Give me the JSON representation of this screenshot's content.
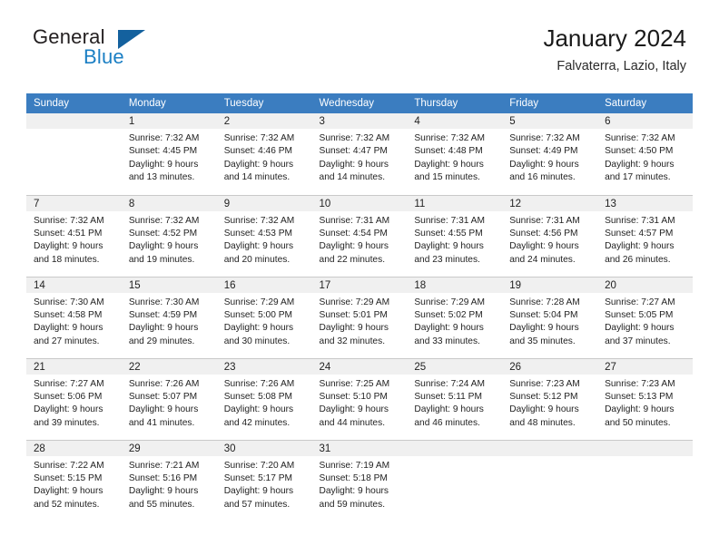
{
  "brand": {
    "name_part1": "General",
    "name_part2": "Blue",
    "flag_icon": "triangle-flag-icon"
  },
  "header": {
    "title": "January 2024",
    "location": "Falvaterra, Lazio, Italy"
  },
  "calendar": {
    "weekday_headers": [
      "Sunday",
      "Monday",
      "Tuesday",
      "Wednesday",
      "Thursday",
      "Friday",
      "Saturday"
    ],
    "accent_color": "#3b7dc0",
    "daynum_bg_color": "#f0f0f0",
    "weeks": [
      [
        {
          "day": "",
          "sunrise": "",
          "sunset": "",
          "daylight_line1": "",
          "daylight_line2": ""
        },
        {
          "day": "1",
          "sunrise": "Sunrise: 7:32 AM",
          "sunset": "Sunset: 4:45 PM",
          "daylight_line1": "Daylight: 9 hours",
          "daylight_line2": "and 13 minutes."
        },
        {
          "day": "2",
          "sunrise": "Sunrise: 7:32 AM",
          "sunset": "Sunset: 4:46 PM",
          "daylight_line1": "Daylight: 9 hours",
          "daylight_line2": "and 14 minutes."
        },
        {
          "day": "3",
          "sunrise": "Sunrise: 7:32 AM",
          "sunset": "Sunset: 4:47 PM",
          "daylight_line1": "Daylight: 9 hours",
          "daylight_line2": "and 14 minutes."
        },
        {
          "day": "4",
          "sunrise": "Sunrise: 7:32 AM",
          "sunset": "Sunset: 4:48 PM",
          "daylight_line1": "Daylight: 9 hours",
          "daylight_line2": "and 15 minutes."
        },
        {
          "day": "5",
          "sunrise": "Sunrise: 7:32 AM",
          "sunset": "Sunset: 4:49 PM",
          "daylight_line1": "Daylight: 9 hours",
          "daylight_line2": "and 16 minutes."
        },
        {
          "day": "6",
          "sunrise": "Sunrise: 7:32 AM",
          "sunset": "Sunset: 4:50 PM",
          "daylight_line1": "Daylight: 9 hours",
          "daylight_line2": "and 17 minutes."
        }
      ],
      [
        {
          "day": "7",
          "sunrise": "Sunrise: 7:32 AM",
          "sunset": "Sunset: 4:51 PM",
          "daylight_line1": "Daylight: 9 hours",
          "daylight_line2": "and 18 minutes."
        },
        {
          "day": "8",
          "sunrise": "Sunrise: 7:32 AM",
          "sunset": "Sunset: 4:52 PM",
          "daylight_line1": "Daylight: 9 hours",
          "daylight_line2": "and 19 minutes."
        },
        {
          "day": "9",
          "sunrise": "Sunrise: 7:32 AM",
          "sunset": "Sunset: 4:53 PM",
          "daylight_line1": "Daylight: 9 hours",
          "daylight_line2": "and 20 minutes."
        },
        {
          "day": "10",
          "sunrise": "Sunrise: 7:31 AM",
          "sunset": "Sunset: 4:54 PM",
          "daylight_line1": "Daylight: 9 hours",
          "daylight_line2": "and 22 minutes."
        },
        {
          "day": "11",
          "sunrise": "Sunrise: 7:31 AM",
          "sunset": "Sunset: 4:55 PM",
          "daylight_line1": "Daylight: 9 hours",
          "daylight_line2": "and 23 minutes."
        },
        {
          "day": "12",
          "sunrise": "Sunrise: 7:31 AM",
          "sunset": "Sunset: 4:56 PM",
          "daylight_line1": "Daylight: 9 hours",
          "daylight_line2": "and 24 minutes."
        },
        {
          "day": "13",
          "sunrise": "Sunrise: 7:31 AM",
          "sunset": "Sunset: 4:57 PM",
          "daylight_line1": "Daylight: 9 hours",
          "daylight_line2": "and 26 minutes."
        }
      ],
      [
        {
          "day": "14",
          "sunrise": "Sunrise: 7:30 AM",
          "sunset": "Sunset: 4:58 PM",
          "daylight_line1": "Daylight: 9 hours",
          "daylight_line2": "and 27 minutes."
        },
        {
          "day": "15",
          "sunrise": "Sunrise: 7:30 AM",
          "sunset": "Sunset: 4:59 PM",
          "daylight_line1": "Daylight: 9 hours",
          "daylight_line2": "and 29 minutes."
        },
        {
          "day": "16",
          "sunrise": "Sunrise: 7:29 AM",
          "sunset": "Sunset: 5:00 PM",
          "daylight_line1": "Daylight: 9 hours",
          "daylight_line2": "and 30 minutes."
        },
        {
          "day": "17",
          "sunrise": "Sunrise: 7:29 AM",
          "sunset": "Sunset: 5:01 PM",
          "daylight_line1": "Daylight: 9 hours",
          "daylight_line2": "and 32 minutes."
        },
        {
          "day": "18",
          "sunrise": "Sunrise: 7:29 AM",
          "sunset": "Sunset: 5:02 PM",
          "daylight_line1": "Daylight: 9 hours",
          "daylight_line2": "and 33 minutes."
        },
        {
          "day": "19",
          "sunrise": "Sunrise: 7:28 AM",
          "sunset": "Sunset: 5:04 PM",
          "daylight_line1": "Daylight: 9 hours",
          "daylight_line2": "and 35 minutes."
        },
        {
          "day": "20",
          "sunrise": "Sunrise: 7:27 AM",
          "sunset": "Sunset: 5:05 PM",
          "daylight_line1": "Daylight: 9 hours",
          "daylight_line2": "and 37 minutes."
        }
      ],
      [
        {
          "day": "21",
          "sunrise": "Sunrise: 7:27 AM",
          "sunset": "Sunset: 5:06 PM",
          "daylight_line1": "Daylight: 9 hours",
          "daylight_line2": "and 39 minutes."
        },
        {
          "day": "22",
          "sunrise": "Sunrise: 7:26 AM",
          "sunset": "Sunset: 5:07 PM",
          "daylight_line1": "Daylight: 9 hours",
          "daylight_line2": "and 41 minutes."
        },
        {
          "day": "23",
          "sunrise": "Sunrise: 7:26 AM",
          "sunset": "Sunset: 5:08 PM",
          "daylight_line1": "Daylight: 9 hours",
          "daylight_line2": "and 42 minutes."
        },
        {
          "day": "24",
          "sunrise": "Sunrise: 7:25 AM",
          "sunset": "Sunset: 5:10 PM",
          "daylight_line1": "Daylight: 9 hours",
          "daylight_line2": "and 44 minutes."
        },
        {
          "day": "25",
          "sunrise": "Sunrise: 7:24 AM",
          "sunset": "Sunset: 5:11 PM",
          "daylight_line1": "Daylight: 9 hours",
          "daylight_line2": "and 46 minutes."
        },
        {
          "day": "26",
          "sunrise": "Sunrise: 7:23 AM",
          "sunset": "Sunset: 5:12 PM",
          "daylight_line1": "Daylight: 9 hours",
          "daylight_line2": "and 48 minutes."
        },
        {
          "day": "27",
          "sunrise": "Sunrise: 7:23 AM",
          "sunset": "Sunset: 5:13 PM",
          "daylight_line1": "Daylight: 9 hours",
          "daylight_line2": "and 50 minutes."
        }
      ],
      [
        {
          "day": "28",
          "sunrise": "Sunrise: 7:22 AM",
          "sunset": "Sunset: 5:15 PM",
          "daylight_line1": "Daylight: 9 hours",
          "daylight_line2": "and 52 minutes."
        },
        {
          "day": "29",
          "sunrise": "Sunrise: 7:21 AM",
          "sunset": "Sunset: 5:16 PM",
          "daylight_line1": "Daylight: 9 hours",
          "daylight_line2": "and 55 minutes."
        },
        {
          "day": "30",
          "sunrise": "Sunrise: 7:20 AM",
          "sunset": "Sunset: 5:17 PM",
          "daylight_line1": "Daylight: 9 hours",
          "daylight_line2": "and 57 minutes."
        },
        {
          "day": "31",
          "sunrise": "Sunrise: 7:19 AM",
          "sunset": "Sunset: 5:18 PM",
          "daylight_line1": "Daylight: 9 hours",
          "daylight_line2": "and 59 minutes."
        },
        {
          "day": "",
          "sunrise": "",
          "sunset": "",
          "daylight_line1": "",
          "daylight_line2": ""
        },
        {
          "day": "",
          "sunrise": "",
          "sunset": "",
          "daylight_line1": "",
          "daylight_line2": ""
        },
        {
          "day": "",
          "sunrise": "",
          "sunset": "",
          "daylight_line1": "",
          "daylight_line2": ""
        }
      ]
    ]
  }
}
